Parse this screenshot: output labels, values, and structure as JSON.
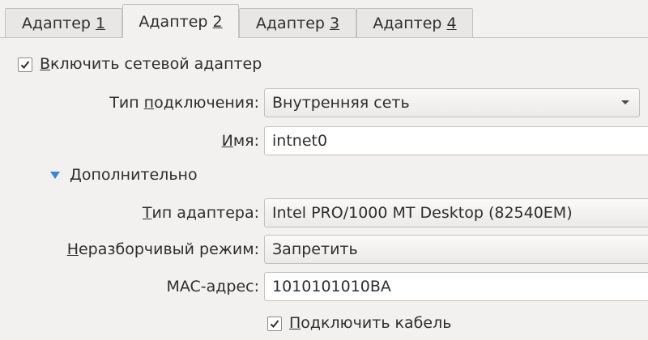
{
  "tabs": [
    {
      "prefix": "Адаптер ",
      "key": "1",
      "active": false
    },
    {
      "prefix": "Адаптер ",
      "key": "2",
      "active": true
    },
    {
      "prefix": "Адаптер ",
      "key": "3",
      "active": false
    },
    {
      "prefix": "Адаптер ",
      "key": "4",
      "active": false
    }
  ],
  "enable_adapter": {
    "checked": true,
    "key": "В",
    "rest": "ключить сетевой адаптер"
  },
  "attached_to": {
    "label_pre": "Тип ",
    "label_key": "п",
    "label_post": "одключения:",
    "value": "Внутренняя сеть"
  },
  "name": {
    "label_key": "И",
    "label_post": "мя:",
    "value": "intnet0"
  },
  "advanced": {
    "key": "Д",
    "rest": "ополнительно"
  },
  "adapter_type": {
    "label_key": "Т",
    "label_post": "ип адаптера:",
    "value": "Intel PRO/1000 MT Desktop (82540EM)"
  },
  "promiscuous": {
    "label_key": "Н",
    "label_post": "еразборчивый режим:",
    "value": "Запретить"
  },
  "mac": {
    "label": "MAC-адрес:",
    "value": "1010101010BA"
  },
  "cable": {
    "checked": true,
    "key": "П",
    "rest": "одключить кабель"
  },
  "icons": {
    "check": "check-icon",
    "dropdown": "dropdown-arrow-icon",
    "expander": "expander-triangle-icon"
  },
  "colors": {
    "background": "#f2f1f0",
    "expander": "#3a87d8",
    "field_bg": "#ffffff",
    "border": "#c4c2bf"
  }
}
